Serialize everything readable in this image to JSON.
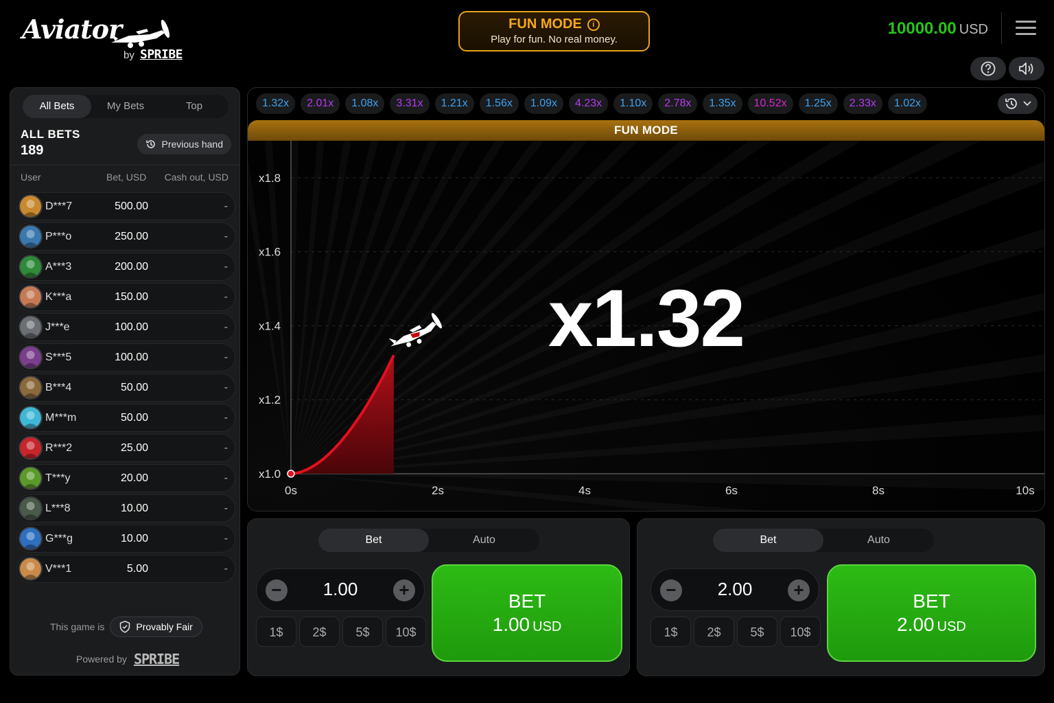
{
  "header": {
    "logo_word": "Aviator",
    "logo_by": "by",
    "logo_brand": "SPRIBE",
    "fun_title": "FUN MODE",
    "fun_subtitle": "Play for fun. No real money.",
    "balance_amount": "10000.00",
    "balance_currency": "USD",
    "icons": [
      "help-icon",
      "sound-icon",
      "menu-icon"
    ]
  },
  "left_panel": {
    "tabs": [
      "All Bets",
      "My Bets",
      "Top"
    ],
    "active_tab": "All Bets",
    "title": "ALL BETS",
    "count": "189",
    "prev_hand_label": "Previous hand",
    "columns": [
      "User",
      "Bet, USD",
      "Cash out, USD"
    ],
    "rows": [
      {
        "user": "D***7",
        "bet": "500.00",
        "cashout": "-",
        "avatar_color": "#c9892f"
      },
      {
        "user": "P***o",
        "bet": "250.00",
        "cashout": "-",
        "avatar_color": "#3a78b0"
      },
      {
        "user": "A***3",
        "bet": "200.00",
        "cashout": "-",
        "avatar_color": "#2f8a3a"
      },
      {
        "user": "K***a",
        "bet": "150.00",
        "cashout": "-",
        "avatar_color": "#c57a55"
      },
      {
        "user": "J***e",
        "bet": "100.00",
        "cashout": "-",
        "avatar_color": "#6b6f74"
      },
      {
        "user": "S***5",
        "bet": "100.00",
        "cashout": "-",
        "avatar_color": "#7a3f8c"
      },
      {
        "user": "B***4",
        "bet": "50.00",
        "cashout": "-",
        "avatar_color": "#8a6a3a"
      },
      {
        "user": "M***m",
        "bet": "50.00",
        "cashout": "-",
        "avatar_color": "#3fb7d6"
      },
      {
        "user": "R***2",
        "bet": "25.00",
        "cashout": "-",
        "avatar_color": "#c6262a"
      },
      {
        "user": "T***y",
        "bet": "20.00",
        "cashout": "-",
        "avatar_color": "#5a9a2a"
      },
      {
        "user": "L***8",
        "bet": "10.00",
        "cashout": "-",
        "avatar_color": "#4a5a4a"
      },
      {
        "user": "G***g",
        "bet": "10.00",
        "cashout": "-",
        "avatar_color": "#2f6fc0"
      },
      {
        "user": "V***1",
        "bet": "5.00",
        "cashout": "-",
        "avatar_color": "#c98a4a"
      }
    ],
    "fair_prefix": "This game is",
    "fair_label": "Provably Fair",
    "powered_prefix": "Powered by",
    "powered_brand": "SPRIBE"
  },
  "game": {
    "history": [
      {
        "value": "1.32x",
        "color": "#3da2f0"
      },
      {
        "value": "2.01x",
        "color": "#b53cf0"
      },
      {
        "value": "1.08x",
        "color": "#3da2f0"
      },
      {
        "value": "3.31x",
        "color": "#b53cf0"
      },
      {
        "value": "1.21x",
        "color": "#3da2f0"
      },
      {
        "value": "1.56x",
        "color": "#3da2f0"
      },
      {
        "value": "1.09x",
        "color": "#3da2f0"
      },
      {
        "value": "4.23x",
        "color": "#b53cf0"
      },
      {
        "value": "1.10x",
        "color": "#3da2f0"
      },
      {
        "value": "2.78x",
        "color": "#b53cf0"
      },
      {
        "value": "1.35x",
        "color": "#3da2f0"
      },
      {
        "value": "10.52x",
        "color": "#d62ad0"
      },
      {
        "value": "1.25x",
        "color": "#3da2f0"
      },
      {
        "value": "2.33x",
        "color": "#b53cf0"
      },
      {
        "value": "1.02x",
        "color": "#3da2f0"
      }
    ],
    "banner": "FUN MODE",
    "current_multiplier": "x1.32",
    "y_ticks": [
      "x1.0",
      "x1.2",
      "x1.4",
      "x1.6",
      "x1.8"
    ],
    "x_ticks": [
      "0s",
      "2s",
      "4s",
      "6s",
      "8s",
      "10s"
    ],
    "flight_curve": {
      "x_range": [
        0,
        10
      ],
      "elapsed_s": 1.4,
      "multiplier_now": 1.32
    },
    "accent_color": "#e2101e"
  },
  "bet_panels": [
    {
      "tabs": [
        "Bet",
        "Auto"
      ],
      "active_tab": "Bet",
      "amount": "1.00",
      "quick": [
        "1$",
        "2$",
        "5$",
        "10$"
      ],
      "button_title": "BET",
      "button_amount": "1.00",
      "button_currency": "USD"
    },
    {
      "tabs": [
        "Bet",
        "Auto"
      ],
      "active_tab": "Bet",
      "amount": "2.00",
      "quick": [
        "1$",
        "2$",
        "5$",
        "10$"
      ],
      "button_title": "BET",
      "button_amount": "2.00",
      "button_currency": "USD"
    }
  ]
}
